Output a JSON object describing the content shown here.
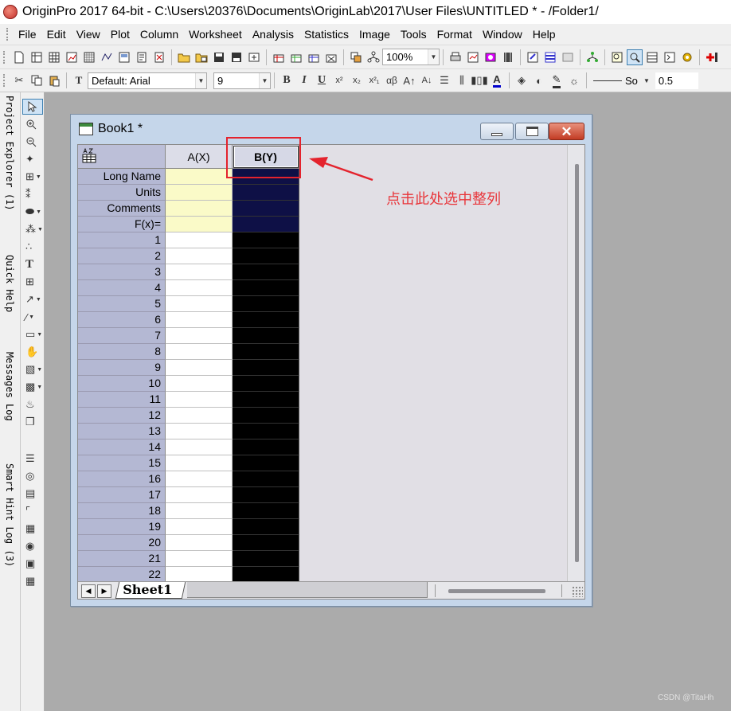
{
  "app": {
    "title": "OriginPro 2017 64-bit - C:\\Users\\20376\\Documents\\OriginLab\\2017\\User Files\\UNTITLED * - /Folder1/"
  },
  "menu": [
    "File",
    "Edit",
    "View",
    "Plot",
    "Column",
    "Worksheet",
    "Analysis",
    "Statistics",
    "Image",
    "Tools",
    "Format",
    "Window",
    "Help"
  ],
  "toolbar": {
    "zoom": "100%",
    "font_name": "Default: Arial",
    "font_size": "9",
    "format_buttons": [
      "B",
      "I",
      "U"
    ],
    "line_style": "So",
    "line_width": "0.5"
  },
  "side_tabs": [
    "Project Explorer (1)",
    "Quick Help",
    "Messages Log",
    "Smart Hint Log (3)"
  ],
  "book": {
    "title": "Book1 *",
    "columns": [
      "A(X)",
      "B(Y)"
    ],
    "meta_rows": [
      "Long Name",
      "Units",
      "Comments",
      "F(x)="
    ],
    "rows": [
      "1",
      "2",
      "3",
      "4",
      "5",
      "6",
      "7",
      "8",
      "9",
      "10",
      "11",
      "12",
      "13",
      "14",
      "15",
      "16",
      "17",
      "18",
      "19",
      "20",
      "21",
      "22"
    ],
    "sheet_tab": "Sheet1",
    "selected_column": "B(Y)"
  },
  "annotation": {
    "text": "点击此处选中整列",
    "color": "#e8353a"
  },
  "watermark": "CSDN @TitaHh",
  "colors": {
    "selected_meta": "#0e1046",
    "selected_data": "#000000",
    "meta_cell": "#fafac8",
    "row_header": "#b4b8d3",
    "highlight": "#e4232d"
  }
}
